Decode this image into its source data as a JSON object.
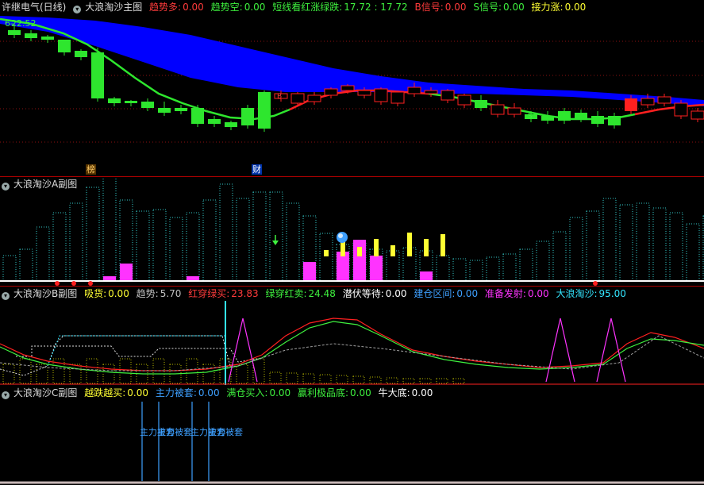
{
  "main": {
    "stock_name": "许继电气(日线)",
    "title": "大浪淘沙主图",
    "indicators": [
      {
        "label": "趋势多:",
        "value": "0.00",
        "color": "#ff3b3b",
        "vcolor": "#ff3b3b"
      },
      {
        "label": "趋势空:",
        "value": "0.00",
        "color": "#3ef03e",
        "vcolor": "#3ef03e"
      },
      {
        "label": "短线看红涨绿跌:",
        "value": "17.72 : 17.72",
        "color": "#3ef03e",
        "vcolor": "#3ef03e"
      },
      {
        "label": "B信号:",
        "value": "0.00",
        "color": "#ff3b3b",
        "vcolor": "#ff3b3b"
      },
      {
        "label": "S信号:",
        "value": "0.00",
        "color": "#3ef03e",
        "vcolor": "#3ef03e"
      },
      {
        "label": "接力涨:",
        "value": "0.00",
        "color": "#ffff33",
        "vcolor": "#ffff33"
      }
    ],
    "price_label": "22.52",
    "markers": [
      "榜",
      "财"
    ],
    "small_markers": [
      "B",
      "S"
    ]
  },
  "sub_a": {
    "title": "大浪淘沙A副图"
  },
  "sub_b": {
    "title": "大浪淘沙B副图",
    "indicators": [
      {
        "label": "吸货:",
        "value": "0.00",
        "color": "#ffff33",
        "vcolor": "#ffff33"
      },
      {
        "label": "趋势:",
        "value": "5.70",
        "color": "#c0c0c0",
        "vcolor": "#c0c0c0"
      },
      {
        "label": "红穿绿买:",
        "value": "23.83",
        "color": "#ff3b3b",
        "vcolor": "#ff3b3b"
      },
      {
        "label": "绿穿红卖:",
        "value": "24.48",
        "color": "#3ef03e",
        "vcolor": "#3ef03e"
      },
      {
        "label": "潜伏等待:",
        "value": "0.00",
        "color": "#ffffff",
        "vcolor": "#ffffff"
      },
      {
        "label": "建仓区间:",
        "value": "0.00",
        "color": "#3ea0ff",
        "vcolor": "#3ea0ff"
      },
      {
        "label": "准备发射:",
        "value": "0.00",
        "color": "#ff33ff",
        "vcolor": "#ff33ff"
      },
      {
        "label": "大浪淘沙:",
        "value": "95.00",
        "color": "#33e6ff",
        "vcolor": "#33e6ff"
      }
    ]
  },
  "sub_c": {
    "title": "大浪淘沙C副图",
    "indicators": [
      {
        "label": "越跌越买:",
        "value": "0.00",
        "color": "#ffff33",
        "vcolor": "#ffff33"
      },
      {
        "label": "主力被套:",
        "value": "0.00",
        "color": "#3ea0ff",
        "vcolor": "#3ea0ff"
      },
      {
        "label": "满仓买入:",
        "value": "0.00",
        "color": "#3ef03e",
        "vcolor": "#3ef03e"
      },
      {
        "label": "赢利极品底:",
        "value": "0.00",
        "color": "#3ef03e",
        "vcolor": "#3ef03e"
      },
      {
        "label": "牛大底:",
        "value": "0.00",
        "color": "#ffffff",
        "vcolor": "#ffffff"
      }
    ],
    "signal_labels": [
      "主力被套",
      "主力被套",
      "主力被套",
      "主力被套"
    ]
  }
}
